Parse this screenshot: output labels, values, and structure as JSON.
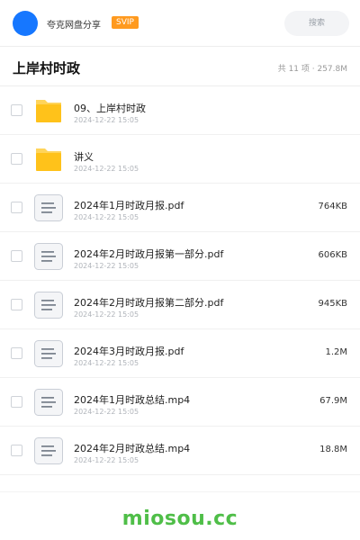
{
  "header": {
    "username": "夸克网盘分享",
    "badge": "SVIP",
    "search_placeholder": "搜索",
    "avatar_color": "#1677ff"
  },
  "folder": {
    "title": "上岸村时政",
    "summary": "共 11 项 · 257.8M"
  },
  "files": [
    {
      "type": "folder",
      "icon": "folder-icon",
      "name": "09、上岸村时政",
      "date": "2024-12-22 15:05",
      "size": ""
    },
    {
      "type": "folder",
      "icon": "folder-icon",
      "name": "讲义",
      "date": "2024-12-22 15:05",
      "size": ""
    },
    {
      "type": "file",
      "icon": "document-icon",
      "name": "2024年1月时政月报.pdf",
      "date": "2024-12-22 15:05",
      "size": "764KB"
    },
    {
      "type": "file",
      "icon": "document-icon",
      "name": "2024年2月时政月报第一部分.pdf",
      "date": "2024-12-22 15:05",
      "size": "606KB"
    },
    {
      "type": "file",
      "icon": "document-icon",
      "name": "2024年2月时政月报第二部分.pdf",
      "date": "2024-12-22 15:05",
      "size": "945KB"
    },
    {
      "type": "file",
      "icon": "document-icon",
      "name": "2024年3月时政月报.pdf",
      "date": "2024-12-22 15:05",
      "size": "1.2M"
    },
    {
      "type": "file",
      "icon": "document-icon",
      "name": "2024年1月时政总结.mp4",
      "date": "2024-12-22 15:05",
      "size": "67.9M"
    },
    {
      "type": "file",
      "icon": "document-icon",
      "name": "2024年2月时政总结.mp4",
      "date": "2024-12-22 15:05",
      "size": "18.8M"
    }
  ],
  "footer": {
    "watermark": "miosou.cc",
    "watermark_color": "#4fbe48"
  },
  "colors": {
    "folder": "#ffc21a",
    "svip": "#ff9a1f"
  }
}
